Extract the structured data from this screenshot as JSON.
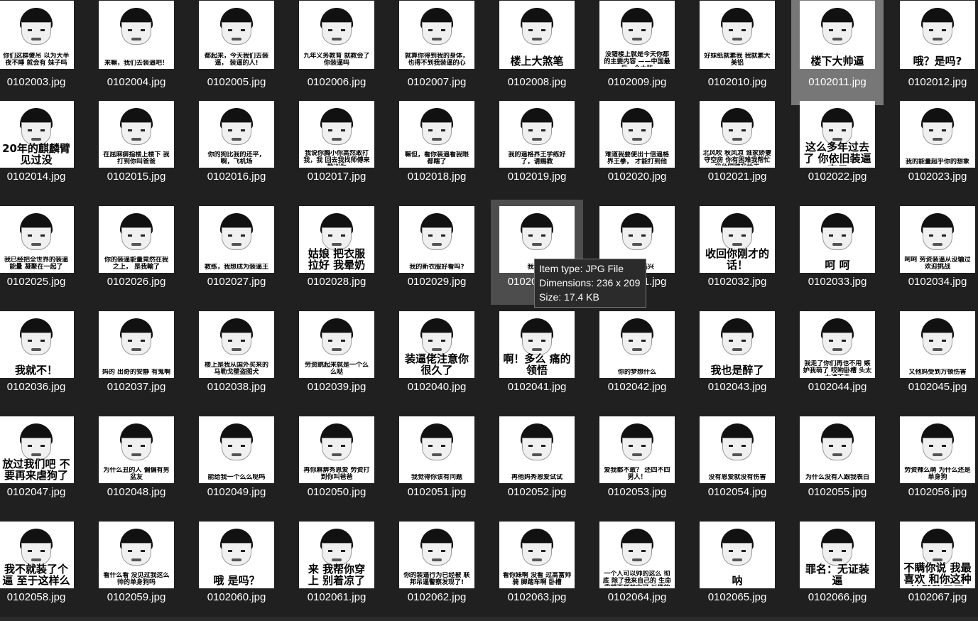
{
  "files": [
    {
      "name": "0102003.jpg",
      "caption": "你们这群傻吊 以为大半夜不睡 就会有 妹子吗"
    },
    {
      "name": "0102004.jpg",
      "caption": "来嘛，我们去装逼吧！"
    },
    {
      "name": "0102005.jpg",
      "caption": "都起来，今天我们去装逼， 装逼的人!"
    },
    {
      "name": "0102006.jpg",
      "caption": "九年义务教育 就教会了你装逼吗"
    },
    {
      "name": "0102007.jpg",
      "caption": "就算你得到我的身体， 也得不到我装逼的心"
    },
    {
      "name": "0102008.jpg",
      "caption": "楼上大煞笔"
    },
    {
      "name": "0102009.jpg",
      "caption": "没错楼上就是今天你都的主要内容 ——中国最后一个太监"
    },
    {
      "name": "0102010.jpg",
      "caption": "好妹纸就素我 我就素大美铝"
    },
    {
      "name": "0102011.jpg",
      "caption": "楼下大帅逼"
    },
    {
      "name": "0102012.jpg",
      "caption": "哦？是吗?"
    },
    {
      "name": "0102014.jpg",
      "caption": "20年的麒麟臂见过没"
    },
    {
      "name": "0102015.jpg",
      "caption": "在屈麻痹指楼上楼下 我打到你叫爸爸"
    },
    {
      "name": "0102016.jpg",
      "caption": "你的狗比我的还平，啊，飞机场"
    },
    {
      "name": "0102017.jpg",
      "caption": "我说你胸小你高然敢打我，我 回去我找师傅来教训你"
    },
    {
      "name": "0102018.jpg",
      "caption": "嘛但，看你装逼看我眼都瞎了"
    },
    {
      "name": "0102019.jpg",
      "caption": "我的逼格界王学练好了，请赐教"
    },
    {
      "name": "0102020.jpg",
      "caption": "难道我要使出十倍逼格界王拳， 才能打到他"
    },
    {
      "name": "0102021.jpg",
      "caption": "北风吹 秋风凉 谁家娇妻守空房 你有困难我帮忙 我住隔壁我姓王"
    },
    {
      "name": "0102022.jpg",
      "caption": "这么多年过去了 你依旧装逼度日"
    },
    {
      "name": "0102023.jpg",
      "caption": "我的能量超乎你的想象"
    },
    {
      "name": "0102025.jpg",
      "caption": "我已经把全世界的装逼能量 凝聚在一起了"
    },
    {
      "name": "0102026.jpg",
      "caption": "你的装逼能量竟然在我之上， 是我輸了"
    },
    {
      "name": "0102027.jpg",
      "caption": "教练，我想成为装逼王"
    },
    {
      "name": "0102028.jpg",
      "caption": "姑娘 把衣服 拉好 我晕奶"
    },
    {
      "name": "0102029.jpg",
      "caption": "我的新衣服好看吗?"
    },
    {
      "name": "0102030.jpg",
      "caption": "我送你"
    },
    {
      "name": "0102031.jpg",
      "caption": "儿子 好高兴"
    },
    {
      "name": "0102032.jpg",
      "caption": "收回你刚才的话！"
    },
    {
      "name": "0102033.jpg",
      "caption": "呵 呵"
    },
    {
      "name": "0102034.jpg",
      "caption": "呵呵 劳资装逼从没输过 欢迎挑战"
    },
    {
      "name": "0102036.jpg",
      "caption": "我就不！"
    },
    {
      "name": "0102037.jpg",
      "caption": "妈的 出奇的安静 有鬼啊"
    },
    {
      "name": "0102038.jpg",
      "caption": "楼上是我从国外买来的 马勒戈壁盗图犬"
    },
    {
      "name": "0102039.jpg",
      "caption": "劳资跳起来就是一个么么哒"
    },
    {
      "name": "0102040.jpg",
      "caption": "装逼佬注意你很久了"
    },
    {
      "name": "0102041.jpg",
      "caption": "啊！多么 痛的领悟"
    },
    {
      "name": "0102042.jpg",
      "caption": "你的梦想什么"
    },
    {
      "name": "0102043.jpg",
      "caption": "我也是醉了"
    },
    {
      "name": "0102044.jpg",
      "caption": "我走了你们再也不用 嫉妒我萌了 哎哟卧槽 头太大进不去"
    },
    {
      "name": "0102045.jpg",
      "caption": "又他妈受到万顿伤害"
    },
    {
      "name": "0102047.jpg",
      "caption": "放过我们吧 不要再来虐狗了"
    },
    {
      "name": "0102048.jpg",
      "caption": "为什么丑的人 偏偏有男盆友"
    },
    {
      "name": "0102049.jpg",
      "caption": "能给我一个么么哒吗"
    },
    {
      "name": "0102050.jpg",
      "caption": "再你麻痹秀恩爱 劳资打到你叫爸爸"
    },
    {
      "name": "0102051.jpg",
      "caption": "我觉得你该有问题"
    },
    {
      "name": "0102052.jpg",
      "caption": "再他妈秀恩爱试试"
    },
    {
      "name": "0102053.jpg",
      "caption": "爱我都不敢？ 还四不四男人！"
    },
    {
      "name": "0102054.jpg",
      "caption": "没有恩爱就没有伤害"
    },
    {
      "name": "0102055.jpg",
      "caption": "为什么没有人跟我表白"
    },
    {
      "name": "0102056.jpg",
      "caption": "劳资辣么萌 为什么还是单身狗"
    },
    {
      "name": "0102058.jpg",
      "caption": "我不就装了个逼 至于这样么"
    },
    {
      "name": "0102059.jpg",
      "caption": "看什么看 没见过我这么帅的单身狗吗"
    },
    {
      "name": "0102060.jpg",
      "caption": "哦 是吗？"
    },
    {
      "name": "0102061.jpg",
      "caption": "来 我帮你穿 上 别着凉了"
    },
    {
      "name": "0102062.jpg",
      "caption": "你的装逼行为已经被 联邦吊逼警察发现了!"
    },
    {
      "name": "0102063.jpg",
      "caption": "看你妹啊 没看 过高富帅骑 脚踏车啊 卧槽"
    },
    {
      "name": "0102064.jpg",
      "caption": "一个人可以帅的这么 彻底 除了我来自己的 生命 我想不到其它可 以做的事 情了"
    },
    {
      "name": "0102065.jpg",
      "caption": "呐"
    },
    {
      "name": "0102066.jpg",
      "caption": "罪名：无证装逼"
    },
    {
      "name": "0102067.jpg",
      "caption": "不瞒你说 我最喜欢 和你这种沙雕聊天了"
    }
  ],
  "hover_tile_name": "0102030.jpg",
  "hover_name_visible": "0102",
  "hover_31_visible": ".jpg",
  "tooltip": {
    "type": "Item type: JPG File",
    "dimensions": "Dimensions: 236 x 209",
    "size": "Size: 17.4 KB"
  },
  "selected_file": "0102011.jpg",
  "colors": {
    "background": "#202020",
    "selected": "#777777",
    "hover": "#4d4d4d",
    "text": "#ffffff"
  }
}
